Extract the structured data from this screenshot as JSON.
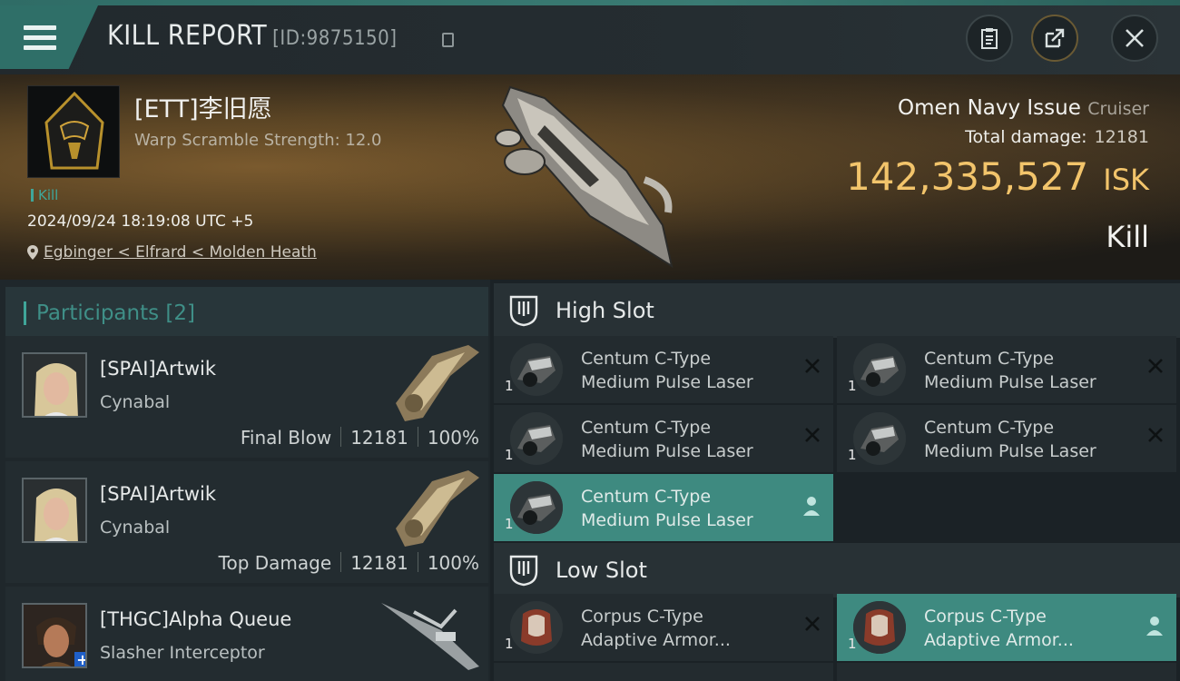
{
  "header": {
    "title": "KILL REPORT",
    "report_id": "[ID:9875150]"
  },
  "victim": {
    "name": "[ETT]李旧愿",
    "warp_scramble": "Warp Scramble Strength: 12.0",
    "tag": "Kill",
    "time": "2024/09/24 18:19:08 UTC +5",
    "location": "Egbinger < Elfrard < Molden Heath",
    "ship_name": "Omen Navy Issue",
    "ship_class": "Cruiser",
    "total_damage_label": "Total damage:",
    "total_damage": "12181",
    "isk_value": "142,335,527",
    "isk_unit": "ISK",
    "result": "Kill"
  },
  "participants": {
    "header": "Participants [2]",
    "rows": [
      {
        "name": "[SPAI]Artwik",
        "ship": "Cynabal",
        "role": "Final Blow",
        "damage": "12181",
        "percent": "100%"
      },
      {
        "name": "[SPAI]Artwik",
        "ship": "Cynabal",
        "role": "Top Damage",
        "damage": "12181",
        "percent": "100%"
      },
      {
        "name": "[THGC]Alpha Queue",
        "ship": "Slasher Interceptor"
      }
    ]
  },
  "slots": {
    "high": {
      "title": "High Slot",
      "modules": [
        {
          "line1": "Centum C-Type",
          "line2": "Medium Pulse Laser",
          "qty": "1"
        },
        {
          "line1": "Centum C-Type",
          "line2": "Medium Pulse Laser",
          "qty": "1"
        },
        {
          "line1": "Centum C-Type",
          "line2": "Medium Pulse Laser",
          "qty": "1"
        },
        {
          "line1": "Centum C-Type",
          "line2": "Medium Pulse Laser",
          "qty": "1"
        },
        {
          "line1": "Centum C-Type",
          "line2": "Medium Pulse Laser",
          "qty": "1"
        }
      ]
    },
    "low": {
      "title": "Low Slot",
      "modules": [
        {
          "line1": "Corpus C-Type",
          "line2": "Adaptive Armor...",
          "qty": "1"
        },
        {
          "line1": "Corpus C-Type",
          "line2": "Adaptive Armor...",
          "qty": "1"
        }
      ]
    }
  },
  "colors": {
    "accent": "#3fa69a",
    "isk": "#f2c46b",
    "selected_module": "#3e8a80"
  }
}
